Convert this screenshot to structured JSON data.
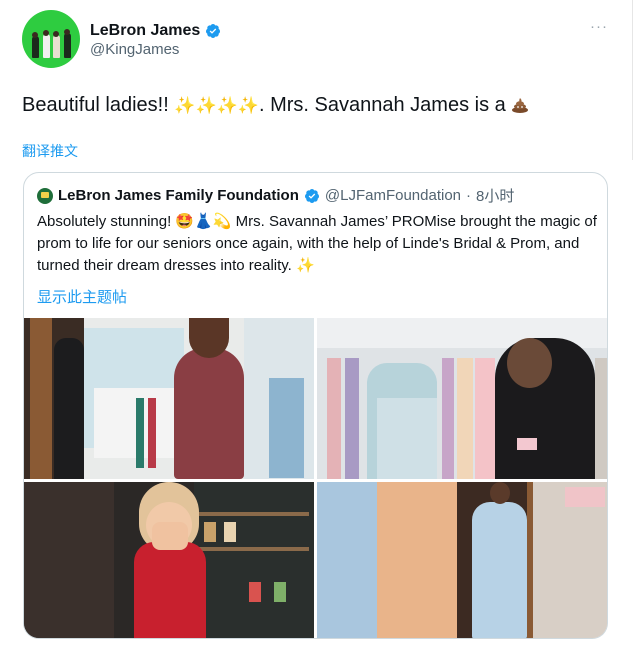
{
  "tweet": {
    "display_name": "LeBron James",
    "handle": "@KingJames",
    "more_icon": "more-icon",
    "text_before": "Beautiful ladies!! ",
    "sparkles": "✨✨✨✨",
    "text_after": ". Mrs. Savannah James is a ",
    "translate_label": "翻译推文"
  },
  "quote": {
    "name": "LeBron James Family Foundation",
    "handle": "@LJFamFoundation",
    "separator": "·",
    "time": "8小时",
    "text": "Absolutely stunning! 🤩👗💫 Mrs. Savannah James’ PROMise brought the magic of prom to life for our seniors once again, with the help of Linde's Bridal & Prom, and turned their dream dresses into reality. ✨",
    "show_thread": "显示此主题帖"
  },
  "colors": {
    "link": "#1d9bf0",
    "verified": "#1d9bf0",
    "secondary_text": "#536471",
    "border": "#cfd9de"
  }
}
